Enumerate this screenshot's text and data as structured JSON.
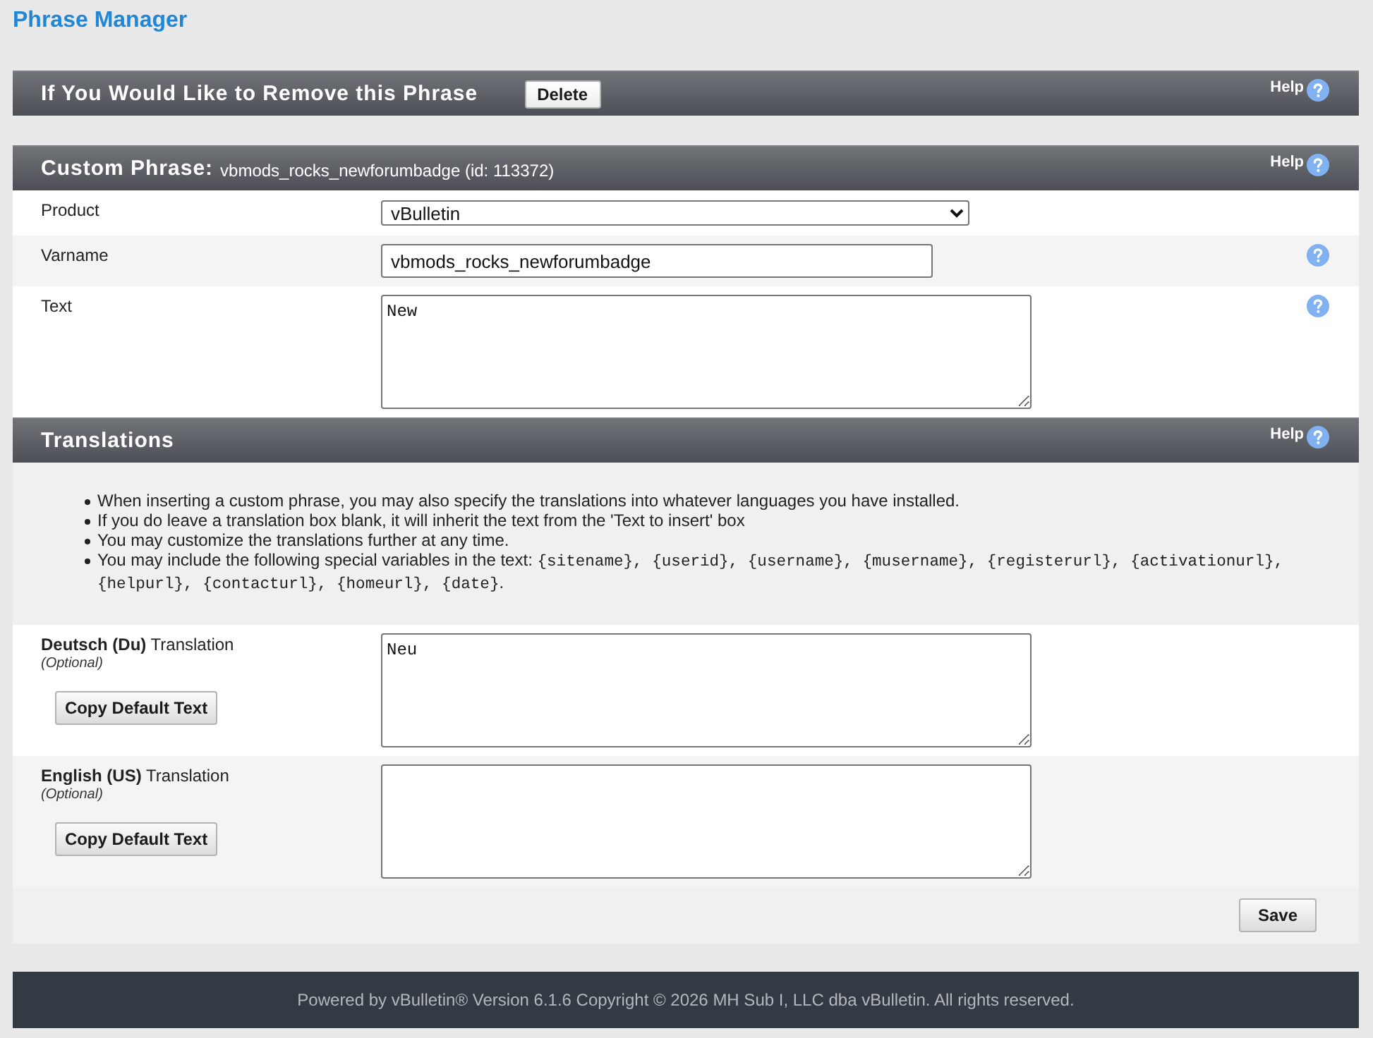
{
  "page": {
    "title": "Phrase Manager"
  },
  "delete_panel": {
    "title": "If You Would Like to Remove this Phrase",
    "button": "Delete",
    "help": "Help"
  },
  "phrase_panel": {
    "title": "Custom Phrase:",
    "subtitle": "vbmods_rocks_newforumbadge (id: 113372)",
    "help": "Help",
    "fields": [
      {
        "kind": "select",
        "label": "Product",
        "value": "vBulletin",
        "help": false
      },
      {
        "kind": "input",
        "label": "Varname",
        "value": "vbmods_rocks_newforumbadge",
        "help": true
      },
      {
        "kind": "textarea",
        "label": "Text",
        "value": "New",
        "help": true
      }
    ]
  },
  "translations_panel": {
    "title": "Translations",
    "help": "Help",
    "notes": [
      [
        {
          "kind": "text",
          "text": "When inserting a custom phrase, you may also specify the translations into whatever languages you have installed."
        }
      ],
      [
        {
          "kind": "text",
          "text": "If you do leave a translation box blank, it will inherit the text from the 'Text to insert' box"
        }
      ],
      [
        {
          "kind": "text",
          "text": "You may customize the translations further at any time."
        }
      ],
      [
        {
          "kind": "text",
          "text": "You may include the following special variables in the text: "
        },
        {
          "kind": "code",
          "text": "{sitename}, {userid}, {username}, {musername}, {registerurl}, {activationurl}, {helpurl}, {contacturl}, {homeurl}, {date}"
        },
        {
          "kind": "text",
          "text": "."
        }
      ]
    ],
    "languages": [
      {
        "label": "**Deutsch (Du)** Translation",
        "hint": "(Optional)",
        "button": "Copy Default Text",
        "value": "Neu"
      },
      {
        "label": "**English (US)** Translation",
        "hint": "(Optional)",
        "button": "Copy Default Text"
      }
    ],
    "save_button": "Save"
  },
  "footer": {
    "text": "Powered by vBulletin® Version 6.1.6 Copyright © 2026 MH Sub I, LLC dba vBulletin. All rights reserved."
  }
}
